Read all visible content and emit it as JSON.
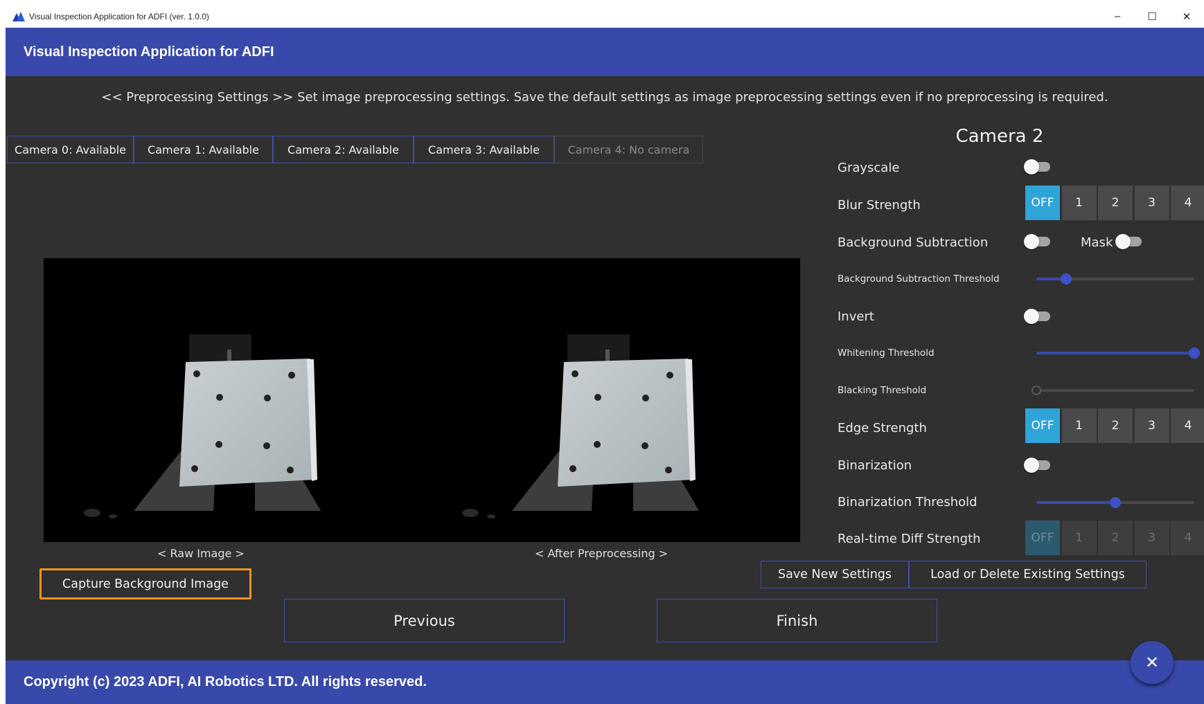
{
  "window": {
    "title": "Visual Inspection Application for ADFI (ver. 1.0.0)",
    "minimize_glyph": "–",
    "maximize_glyph": "☐",
    "close_glyph": "✕"
  },
  "header": {
    "title": "Visual Inspection Application for ADFI"
  },
  "instruction": "<< Preprocessing Settings >>  Set image preprocessing settings. Save the default settings as image preprocessing settings even if no preprocessing is required.",
  "camera_tabs": [
    {
      "label": "Camera 0: Available",
      "enabled": true
    },
    {
      "label": "Camera 1: Available",
      "enabled": true
    },
    {
      "label": "Camera 2: Available",
      "enabled": true
    },
    {
      "label": "Camera 3: Available",
      "enabled": true
    },
    {
      "label": "Camera 4: No camera",
      "enabled": false
    }
  ],
  "preview": {
    "raw_label": "< Raw Image >",
    "processed_label": "< After Preprocessing >"
  },
  "capture_button": "Capture Background Image",
  "nav": {
    "previous": "Previous",
    "finish": "Finish"
  },
  "settings_buttons": {
    "save": "Save New Settings",
    "load": "Load or Delete Existing Settings"
  },
  "settings": {
    "camera_title": "Camera 2",
    "grayscale": {
      "label": "Grayscale",
      "on": false
    },
    "blur_strength": {
      "label": "Blur Strength",
      "options": [
        "OFF",
        "1",
        "2",
        "3",
        "4"
      ],
      "selected": "OFF"
    },
    "background_subtraction": {
      "label": "Background Subtraction",
      "on": false
    },
    "mask": {
      "label": "Mask",
      "on": false
    },
    "background_subtraction_threshold": {
      "label": "Background Subtraction Threshold",
      "value_fraction": 0.19
    },
    "invert": {
      "label": "Invert",
      "on": false
    },
    "whitening_threshold": {
      "label": "Whitening Threshold",
      "value_fraction": 1.0
    },
    "blacking_threshold": {
      "label": "Blacking Threshold",
      "value_fraction": 0.0
    },
    "edge_strength": {
      "label": "Edge Strength",
      "options": [
        "OFF",
        "1",
        "2",
        "3",
        "4"
      ],
      "selected": "OFF"
    },
    "binarization": {
      "label": "Binarization",
      "on": false
    },
    "binarization_threshold": {
      "label": "Binarization Threshold",
      "value_fraction": 0.5
    },
    "realtime_diff_strength": {
      "label": "Real-time Diff Strength",
      "options": [
        "OFF",
        "1",
        "2",
        "3",
        "4"
      ],
      "selected": "OFF",
      "enabled": false
    }
  },
  "footer": "Copyright (c) 2023 ADFI, AI Robotics LTD. All rights reserved.",
  "fab_glyph": "✕",
  "colors": {
    "brand": "#3949ab",
    "background": "#303030",
    "accent_active": "#2fa4d9",
    "highlight_border": "#f5921e"
  }
}
